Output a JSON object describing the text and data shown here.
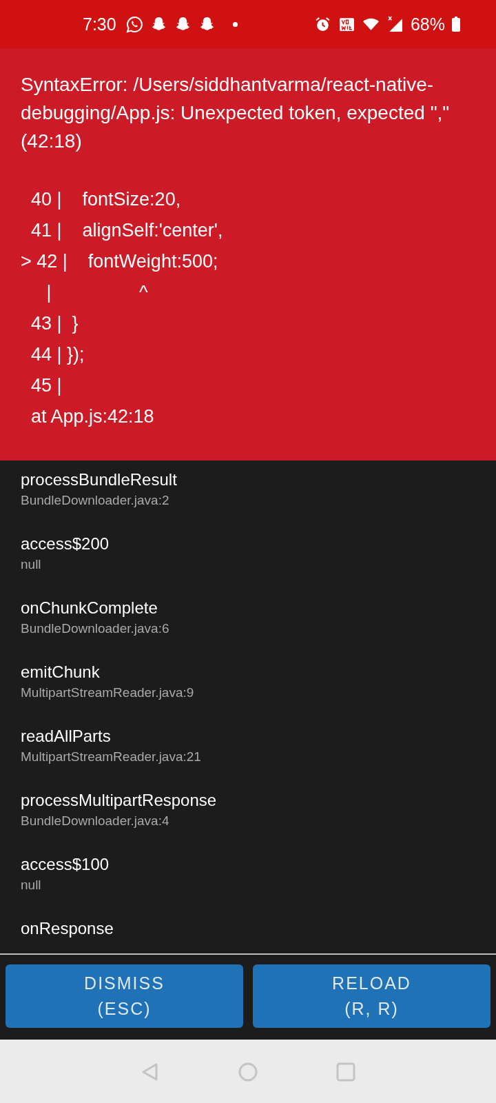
{
  "status_bar": {
    "time": "7:30",
    "battery": "68%"
  },
  "error": {
    "message": "SyntaxError: /Users/siddhantvarma/react-native-debugging/App.js: Unexpected token, expected \",\" (42:18)",
    "code_lines": [
      "  40 |    fontSize:20,",
      "  41 |    alignSelf:'center',",
      "> 42 |    fontWeight:500;",
      "     |                 ^",
      "  43 |  }",
      "  44 | });",
      "  45 |",
      "  at App.js:42:18"
    ]
  },
  "stack": [
    {
      "method": "processBundleResult",
      "location": "BundleDownloader.java:2"
    },
    {
      "method": "access$200",
      "location": "null"
    },
    {
      "method": "onChunkComplete",
      "location": "BundleDownloader.java:6"
    },
    {
      "method": "emitChunk",
      "location": "MultipartStreamReader.java:9"
    },
    {
      "method": "readAllParts",
      "location": "MultipartStreamReader.java:21"
    },
    {
      "method": "processMultipartResponse",
      "location": "BundleDownloader.java:4"
    },
    {
      "method": "access$100",
      "location": "null"
    },
    {
      "method": "onResponse"
    }
  ],
  "buttons": [
    {
      "label": "DISMISS",
      "shortcut": "(ESC)"
    },
    {
      "label": "RELOAD",
      "shortcut": "(R, R)"
    }
  ]
}
